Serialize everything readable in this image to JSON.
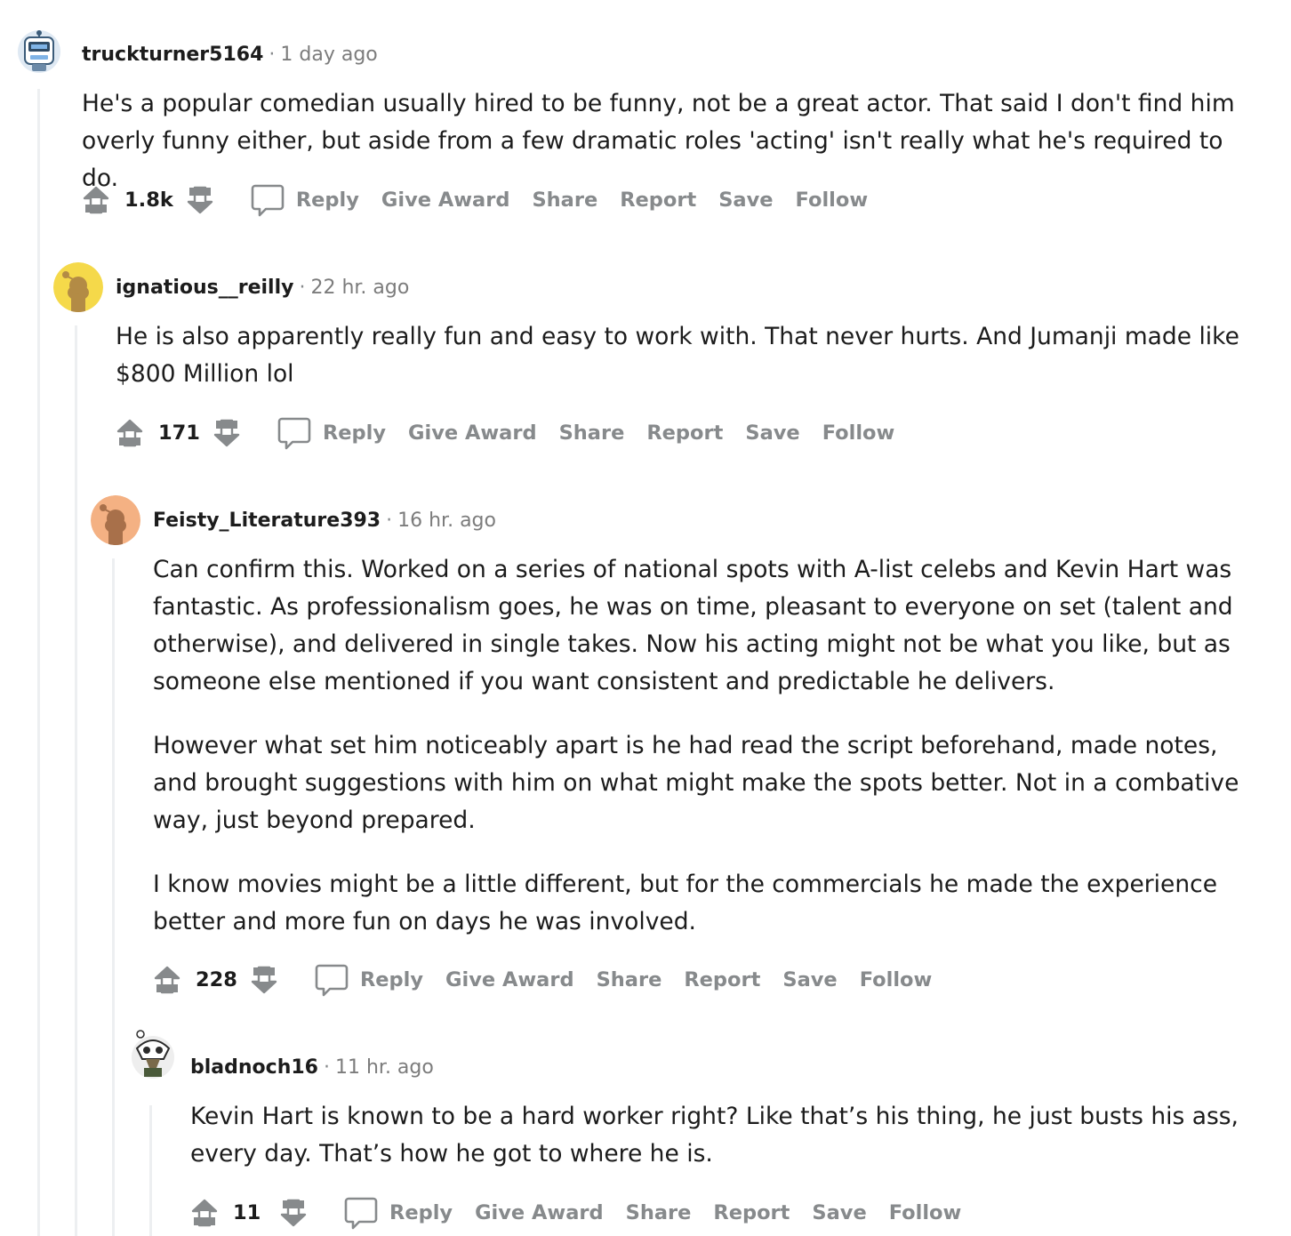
{
  "actions": {
    "reply": "Reply",
    "give_award": "Give Award",
    "share": "Share",
    "report": "Report",
    "save": "Save",
    "follow": "Follow"
  },
  "separator": "·",
  "comments": [
    {
      "author": "truckturner5164",
      "time": "1 day ago",
      "avatar": "robot-avatar-icon",
      "body": [
        "He's a popular comedian usually hired to be funny, not be a great actor. That said I don't find him overly funny either, but aside from a few dramatic roles 'acting' isn't really what he's required to do."
      ],
      "score": "1.8k"
    },
    {
      "author": "ignatious__reilly",
      "time": "22 hr. ago",
      "avatar": "yellow-snoo-avatar-icon",
      "body": [
        "He is also apparently really fun and easy to work with. That never hurts. And Jumanji made like $800 Million lol"
      ],
      "score": "171"
    },
    {
      "author": "Feisty_Literature393",
      "time": "16 hr. ago",
      "avatar": "orange-snoo-avatar-icon",
      "body": [
        "Can confirm this. Worked on a series of national spots with A-list celebs and Kevin Hart was fantastic. As professionalism goes, he was on time, pleasant to everyone on set (talent and otherwise), and delivered in single takes. Now his acting might not be what you like, but as someone else mentioned if you want consistent and predictable he delivers.",
        "However what set him noticeably apart is he had read the script beforehand, made notes, and brought suggestions with him on what might make the spots better. Not in a combative way, just beyond prepared.",
        "I know movies might be a little different, but for the commercials he made the experience better and more fun on days he was involved."
      ],
      "score": "228"
    },
    {
      "author": "bladnoch16",
      "time": "11 hr. ago",
      "avatar": "skull-snoo-avatar-icon",
      "body": [
        "Kevin Hart is known to be a hard worker right? Like that’s his thing, he just busts his ass, every day. That’s how he got to where he is."
      ],
      "score": "11"
    }
  ],
  "colors": {
    "text": "#1c1c1c",
    "meta": "#7c7c7c",
    "action": "#878a8c",
    "thread_line": "#edeff1",
    "avatar_yellow": "#f5d94a",
    "avatar_orange": "#f4b183"
  }
}
